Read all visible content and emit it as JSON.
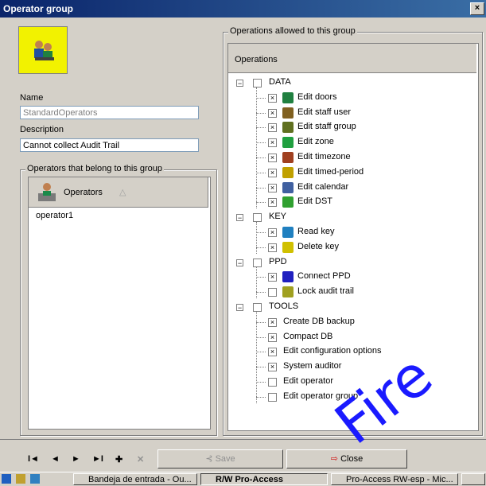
{
  "window": {
    "title": "Operator group",
    "close_label": "×"
  },
  "form": {
    "name_label": "Name",
    "name_value": "StandardOperators",
    "description_label": "Description",
    "description_value": "Cannot collect Audit Trail",
    "operators_group_label": "Operators that belong to this group",
    "operators_column": "Operators",
    "sort_arrow": "△",
    "operators": [
      "operator1"
    ]
  },
  "operations": {
    "group_label": "Operations allowed to this group",
    "column_header": "Operations",
    "tree": [
      {
        "label": "DATA",
        "checked": false,
        "children": [
          {
            "label": "Edit doors",
            "checked": true,
            "icon": "door-icon"
          },
          {
            "label": "Edit staff user",
            "checked": true,
            "icon": "user-icon"
          },
          {
            "label": "Edit staff group",
            "checked": true,
            "icon": "group-icon"
          },
          {
            "label": "Edit zone",
            "checked": true,
            "icon": "zone-icon"
          },
          {
            "label": "Edit timezone",
            "checked": true,
            "icon": "timezone-icon"
          },
          {
            "label": "Edit timed-period",
            "checked": true,
            "icon": "timed-period-icon"
          },
          {
            "label": "Edit calendar",
            "checked": true,
            "icon": "calendar-icon"
          },
          {
            "label": "Edit DST",
            "checked": true,
            "icon": "dst-icon"
          }
        ]
      },
      {
        "label": "KEY",
        "checked": false,
        "children": [
          {
            "label": "Read key",
            "checked": true,
            "icon": "read-key-icon"
          },
          {
            "label": "Delete key",
            "checked": true,
            "icon": "delete-key-icon"
          }
        ]
      },
      {
        "label": "PPD",
        "checked": false,
        "children": [
          {
            "label": "Connect PPD",
            "checked": true,
            "icon": "ppd-icon"
          },
          {
            "label": "Lock audit trail",
            "checked": false,
            "icon": "audit-trail-icon"
          }
        ]
      },
      {
        "label": "TOOLS",
        "checked": false,
        "children": [
          {
            "label": "Create DB backup",
            "checked": true
          },
          {
            "label": "Compact DB",
            "checked": true
          },
          {
            "label": "Edit configuration options",
            "checked": true
          },
          {
            "label": "System auditor",
            "checked": true
          },
          {
            "label": "Edit operator",
            "checked": false
          },
          {
            "label": "Edit operator group",
            "checked": false
          }
        ]
      }
    ]
  },
  "toolbar": {
    "first": "I◄",
    "prev": "◄",
    "next": "►",
    "last": "►I",
    "add": "✚",
    "delete": "✕",
    "save_label": "Save",
    "close_label": "Close"
  },
  "taskbar": {
    "tasks": [
      "Bandeja de entrada - Ou...",
      "R/W Pro-Access",
      "Pro-Access RW-esp - Mic..."
    ]
  },
  "watermark": "Fire"
}
